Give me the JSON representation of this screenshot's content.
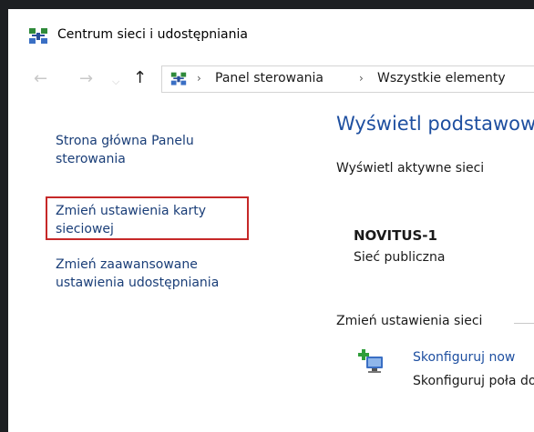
{
  "window": {
    "title": "Centrum sieci i udostępniania",
    "title_icon": "network-center-icon"
  },
  "navigation": {
    "back_icon": "arrow-left-icon",
    "forward_icon": "arrow-right-icon",
    "recent_icon": "chevron-down-icon",
    "up_icon": "arrow-up-icon",
    "back_glyph": "←",
    "forward_glyph": "→",
    "recent_glyph": "⌵",
    "up_glyph": "↑"
  },
  "address": {
    "icon": "network-center-icon",
    "separator": "›",
    "crumbs": [
      "Panel sterowania",
      "Wszystkie elementy"
    ]
  },
  "sidebar": {
    "links": [
      {
        "label": "Strona główna Panelu sterowania"
      },
      {
        "label": "Zmień ustawienia karty sieciowej"
      },
      {
        "label": "Zmień zaawansowane ustawienia udostępniania"
      }
    ],
    "highlight_color": "#c62828"
  },
  "main": {
    "title": "Wyświetl podstawow",
    "active_networks_header": "Wyświetl aktywne sieci",
    "network": {
      "name": "NOVITUS-1",
      "type": "Sieć publiczna"
    },
    "change_settings_header": "Zmień ustawienia sieci",
    "task": {
      "icon": "network-setup-icon",
      "link": "Skonfiguruj now",
      "description": "Skonfiguruj poła dostępu."
    }
  },
  "colors": {
    "link": "#1e4fa0",
    "sidebar_link": "#1a3e78",
    "frame": "#1d1f22"
  }
}
